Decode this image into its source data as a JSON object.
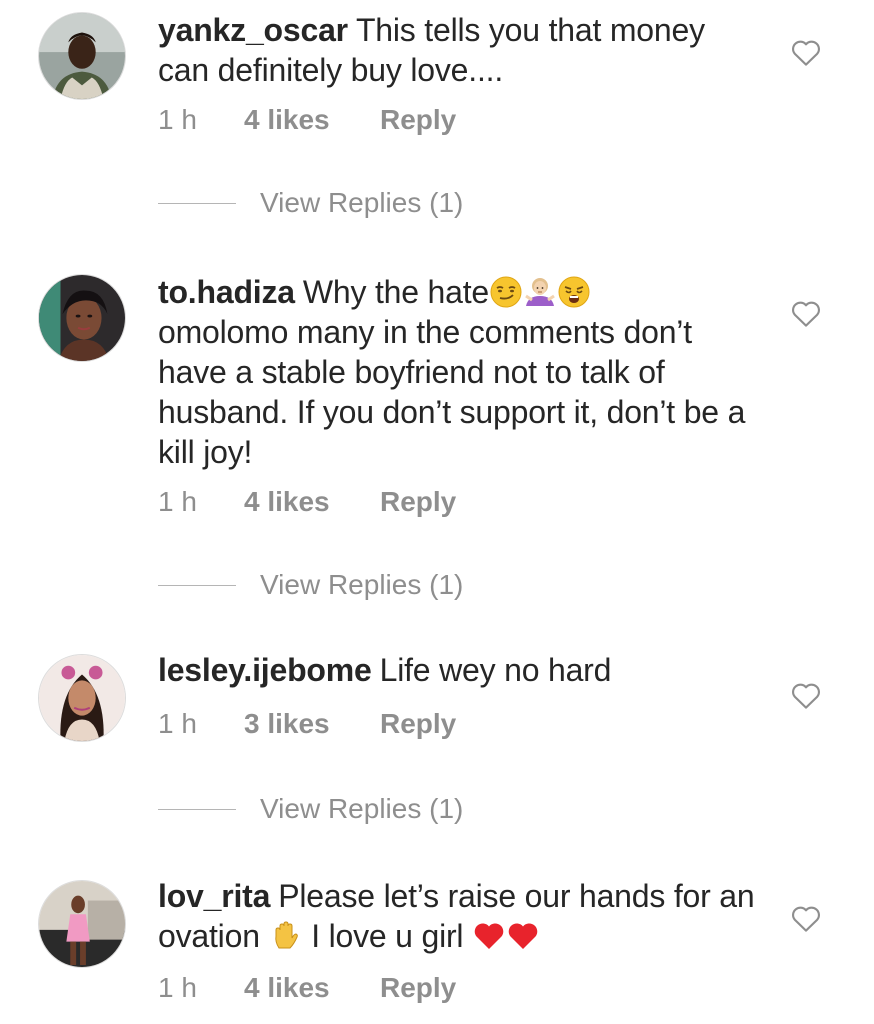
{
  "comments": [
    {
      "username": "yankz_oscar",
      "text_parts": [
        "This tells you that  money can definitely buy love...."
      ],
      "time": "1 h",
      "likes": "4 likes",
      "reply": "Reply",
      "view_replies": "View Replies (1)"
    },
    {
      "username": "to.hadiza",
      "text_before": "Why the hate",
      "emojis": [
        "smirking-face-emoji",
        "woman-shrugging-emoji",
        "weary-face-emoji"
      ],
      "text_after": "omolomo many in the comments don’t have a stable boyfriend not to talk of husband. If you don’t support it, don’t be a kill joy!",
      "time": "1 h",
      "likes": "4 likes",
      "reply": "Reply",
      "view_replies": "View Replies (1)"
    },
    {
      "username": "lesley.ijebome",
      "text_parts": [
        "Life wey no hard"
      ],
      "time": "1 h",
      "likes": "3 likes",
      "reply": "Reply",
      "view_replies": "View Replies (1)"
    },
    {
      "username": "lov_rita",
      "text_before": "Please let’s raise our hands for an ovation",
      "text_middle": "I love u girl",
      "emojis": [
        "raised-hand-emoji",
        "red-heart-emoji",
        "red-heart-emoji"
      ],
      "time": "1 h",
      "likes": "4 likes",
      "reply": "Reply"
    }
  ],
  "colors": {
    "text": "#262626",
    "secondary": "#8e8e8e",
    "divider": "#b5b5b5"
  }
}
